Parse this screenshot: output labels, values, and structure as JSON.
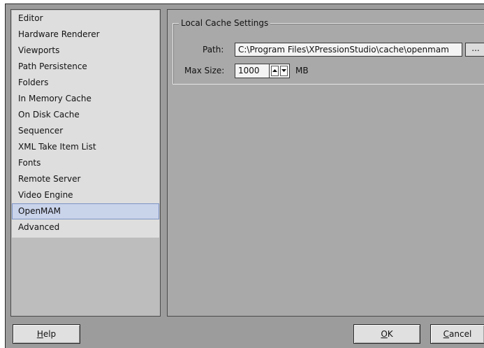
{
  "sidebar": {
    "items": [
      {
        "label": "Editor"
      },
      {
        "label": "Hardware Renderer"
      },
      {
        "label": "Viewports"
      },
      {
        "label": "Path Persistence"
      },
      {
        "label": "Folders"
      },
      {
        "label": "In Memory Cache"
      },
      {
        "label": "On Disk Cache"
      },
      {
        "label": "Sequencer"
      },
      {
        "label": "XML Take Item List"
      },
      {
        "label": "Fonts"
      },
      {
        "label": "Remote Server"
      },
      {
        "label": "Video Engine"
      },
      {
        "label": "OpenMAM"
      },
      {
        "label": "Advanced"
      }
    ],
    "selected_label": "OpenMAM"
  },
  "local_cache": {
    "group_title": "Local Cache Settings",
    "path_label": "Path:",
    "path_value": "C:\\Program Files\\XPressionStudio\\cache\\openmam",
    "browse_label": "...",
    "max_size_label": "Max Size:",
    "max_size_value": "1000",
    "unit": "MB"
  },
  "buttons": {
    "help": {
      "mnemonic": "H",
      "rest": "elp"
    },
    "ok": {
      "mnemonic": "O",
      "rest": "K"
    },
    "cancel": {
      "mnemonic": "C",
      "rest": "ancel"
    }
  },
  "icons": {
    "spin_up": "arrow-up-icon",
    "spin_down": "arrow-down-icon"
  },
  "colors": {
    "selection": "#c9d3ea",
    "selection_border": "#7f95c4"
  }
}
